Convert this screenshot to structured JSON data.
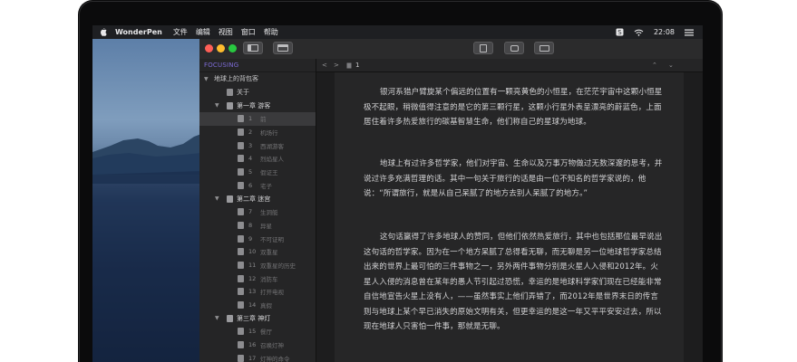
{
  "menubar": {
    "app_name": "WonderPen",
    "items": [
      "文件",
      "编辑",
      "视图",
      "窗口",
      "帮助"
    ],
    "time": "22:08"
  },
  "sidebar": {
    "focus_label": "FOCUSING",
    "rows": [
      {
        "type": "project",
        "label": "地球上的背包客"
      },
      {
        "type": "doc",
        "label": "关于"
      },
      {
        "type": "chapter",
        "label": "第一章 游客"
      },
      {
        "type": "item",
        "num": "1",
        "label": "前"
      },
      {
        "type": "item",
        "num": "2",
        "label": "机场行"
      },
      {
        "type": "item",
        "num": "3",
        "label": "西湖游客"
      },
      {
        "type": "item",
        "num": "4",
        "label": "烈焰星人"
      },
      {
        "type": "item",
        "num": "5",
        "label": "假证王"
      },
      {
        "type": "item",
        "num": "6",
        "label": "宅子"
      },
      {
        "type": "chapter",
        "label": "第二章 迷宫"
      },
      {
        "type": "item",
        "num": "7",
        "label": "生洞艇"
      },
      {
        "type": "item",
        "num": "8",
        "label": "异星"
      },
      {
        "type": "item",
        "num": "9",
        "label": "不可证明"
      },
      {
        "type": "item",
        "num": "10",
        "label": "双重星"
      },
      {
        "type": "item",
        "num": "11",
        "label": "双重星的历史"
      },
      {
        "type": "item",
        "num": "12",
        "label": "消防车"
      },
      {
        "type": "item",
        "num": "13",
        "label": "打开电视"
      },
      {
        "type": "item",
        "num": "14",
        "label": "真假"
      },
      {
        "type": "chapter",
        "label": "第三章 神灯"
      },
      {
        "type": "item",
        "num": "15",
        "label": "餐厅"
      },
      {
        "type": "item",
        "num": "16",
        "label": "召唤灯神"
      },
      {
        "type": "item",
        "num": "17",
        "label": "灯神的命令"
      }
    ]
  },
  "editor": {
    "crumb": "1",
    "paragraphs": [
      "银河系猎户臂旋某个偏远的位置有一颗亮黄色的小恒星，在茫茫宇宙中这颗小恒星极不起眼，稍微值得注意的是它的第三颗行星，这颗小行星外表呈漂亮的蔚蓝色，上面居住着许多热爱旅行的碳基智慧生命，他们称自己的星球为地球。",
      "地球上有过许多哲学家，他们对宇宙、生命以及万事万物做过无数深邃的思考，并说过许多充满哲理的话。其中一句关于旅行的话是由一位不知名的哲学家说的，他说：“所谓旅行，就是从自己呆腻了的地方去别人呆腻了的地方。”",
      "这句话赢得了许多地球人的赞同，但他们依然热爱旅行，其中也包括那位最早说出这句话的哲学家。因为在一个地方呆腻了总得看无聊，而无聊是另一位地球哲学家总结出来的世界上最可怕的三件事物之一，另外两件事物分别是火星人入侵和2012年。火星人入侵的消息曾在某年的愚人节引起过恐慌，幸运的是地球科学家们现在已经能非常自信地宣告火星上没有人，——虽然事实上他们弄错了，而2012年是世界末日的传言则与地球上某个早已消失的原始文明有关，但更幸运的是这一年又平平安安过去，所以现在地球人只害怕一件事，那就是无聊。"
    ]
  }
}
